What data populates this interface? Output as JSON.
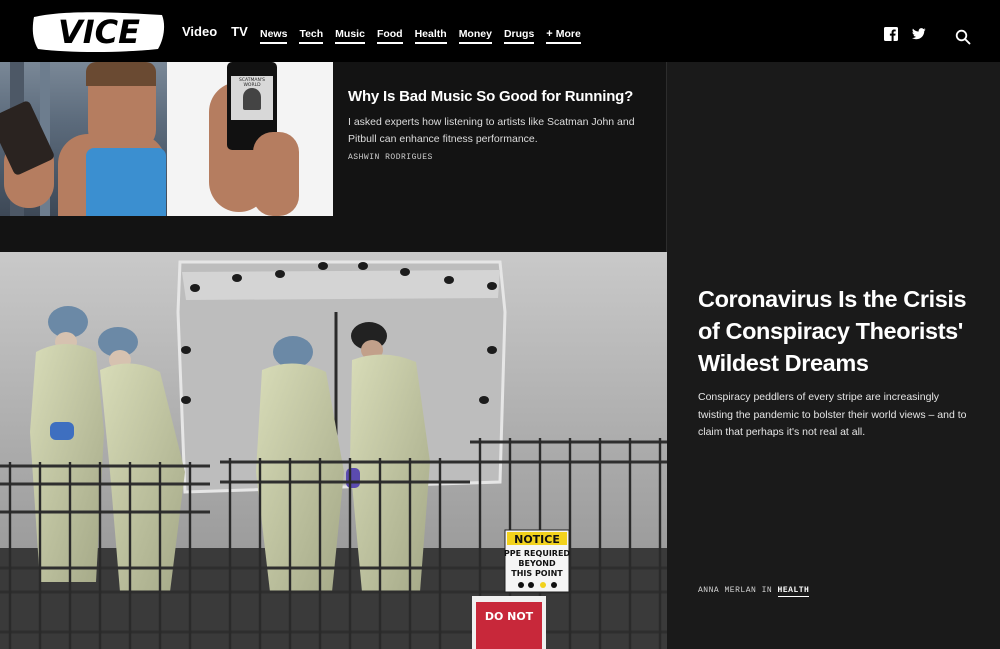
{
  "brand": {
    "logo_text": "VICE"
  },
  "primary_nav": [
    {
      "label": "Video"
    },
    {
      "label": "TV"
    }
  ],
  "section_nav": [
    {
      "label": "News"
    },
    {
      "label": "Tech"
    },
    {
      "label": "Music"
    },
    {
      "label": "Food"
    },
    {
      "label": "Health"
    },
    {
      "label": "Money"
    },
    {
      "label": "Drugs"
    }
  ],
  "more": {
    "plus": "+",
    "label": "More"
  },
  "social_icons": [
    "facebook-icon",
    "twitter-icon"
  ],
  "search_icon": "search-icon",
  "teaser": {
    "title": "Why Is Bad Music So Good for Running?",
    "dek": "I asked experts how listening to artists like Scatman John and Pitbull can enhance fitness performance.",
    "author": "ASHWIN RODRIGUES",
    "phone_screen_text": "SCATMAN'S WORLD"
  },
  "feature": {
    "title": "Coronavirus Is the Crisis of Conspiracy Theorists' Wildest Dreams",
    "dek": "Conspiracy peddlers of every stripe are increasingly twisting the pandemic to bolster their world views – and to claim that perhaps it's not real at all.",
    "author": "ANNA MERLAN",
    "byline_in": "IN",
    "section": "HEALTH"
  },
  "hero_signs": {
    "notice_title": "NOTICE",
    "notice_line1": "PPE REQUIRED",
    "notice_line2": "BEYOND",
    "notice_line3": "THIS POINT",
    "do_not": "DO NOT"
  },
  "colors": {
    "header_bg": "#000000",
    "page_bg": "#1a1a1a",
    "notice_yellow": "#f2d21d",
    "stop_red": "#c8283a"
  }
}
